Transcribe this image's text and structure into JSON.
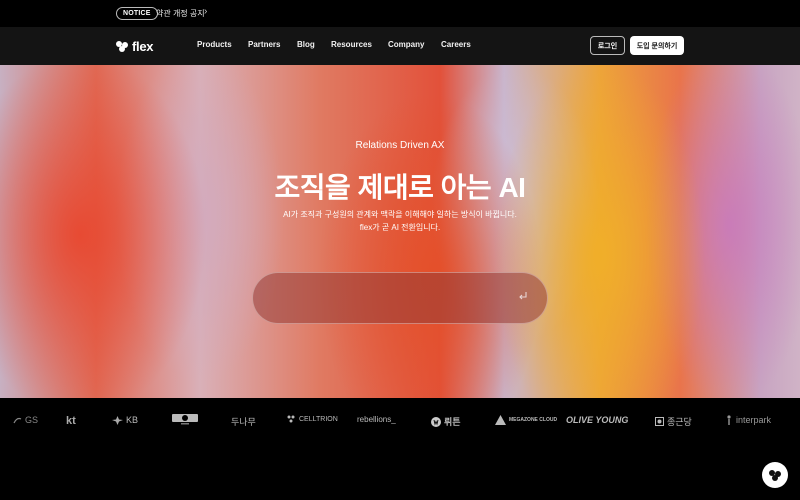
{
  "notice": {
    "badge": "NOTICE",
    "text": "약관 개정 공지",
    "chevron": "›"
  },
  "header": {
    "logo_text": "flex",
    "nav": [
      "Products",
      "Partners",
      "Blog",
      "Resources",
      "Company",
      "Careers"
    ],
    "login_label": "로그인",
    "demo_label": "도입 문의하기"
  },
  "hero": {
    "subtitle": "Relations Driven AX",
    "title": "조직을 제대로 아는 AI",
    "desc_line1": "AI가 조직과 구성원의 관계와 맥락을 이해해야 일하는 방식이 바뀝니다.",
    "desc_line2": "flex가 곧 AI 전환입니다.",
    "prompt_placeholder": "",
    "enter_icon": "enter-icon"
  },
  "clients": [
    "GS",
    "kt",
    "KB",
    "",
    "두나무",
    "CELLTRION",
    "rebellions_",
    "뤼튼",
    "MEGAZONE CLOUD",
    "OLIVE YOUNG",
    "종근당",
    "interpark"
  ],
  "colors": {
    "background": "#000000",
    "header": "#141414",
    "accent_orange": "#eda43a",
    "accent_red": "#e2513a"
  }
}
